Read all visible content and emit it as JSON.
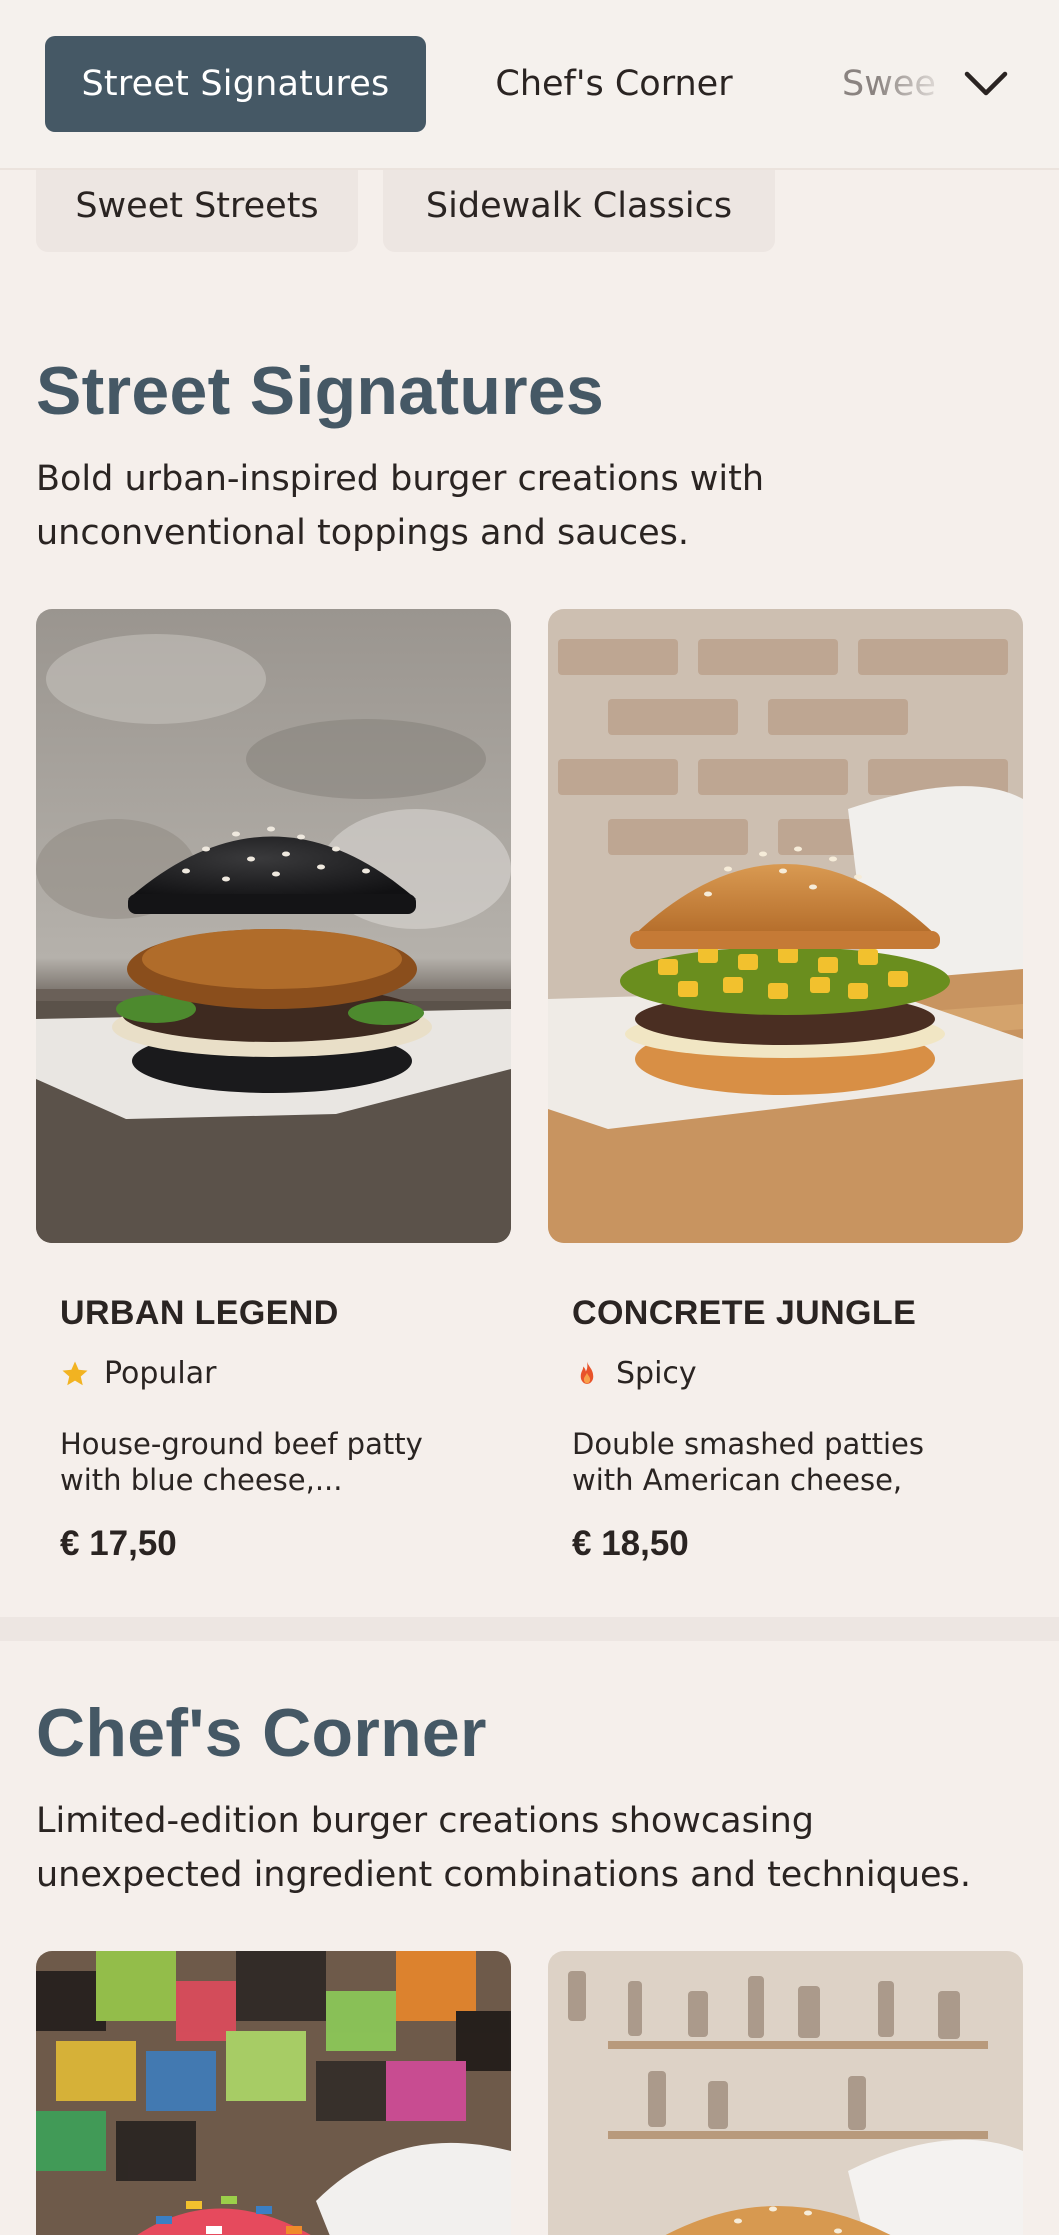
{
  "nav": {
    "active_label": "Street Signatures",
    "tabs": [
      "Street Signatures",
      "Chef's Corner",
      "Swee"
    ],
    "sub_tabs": [
      "Sweet Streets",
      "Sidewalk Classics"
    ],
    "expand_icon": "chevron-down-icon"
  },
  "sections": [
    {
      "title": "Street Signatures",
      "description": "Bold urban-inspired burger creations with unconventional toppings and sauces.",
      "items": [
        {
          "name": "URBAN LEGEND",
          "badge": "Popular",
          "badge_icon": "star-icon",
          "description": "House-ground beef patty with blue cheese,...",
          "price": "€ 17,50"
        },
        {
          "name": "CONCRETE JUNGLE",
          "badge": "Spicy",
          "badge_icon": "flame-icon",
          "description": "Double smashed patties with American cheese, street cor...",
          "price": "€ 18,50"
        }
      ]
    },
    {
      "title": "Chef's Corner",
      "description": "Limited-edition burger creations showcasing unexpected ingredient combinations and techniques.",
      "items": []
    }
  ],
  "colors": {
    "background": "#f5efeb",
    "accent": "#455865",
    "star": "#f2b321",
    "flame": "#e8532a"
  }
}
